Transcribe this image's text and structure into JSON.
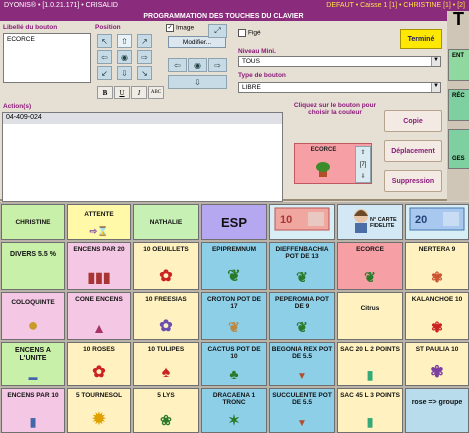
{
  "titlebar": {
    "left": "DYONIS® • [1.0.21.171] • CRISALID",
    "right": "DEFAUT • Caisse 1 [1] • CHRISTINE [1] • [2]"
  },
  "header": "PROGRAMMATION DES TOUCHES DU CLAVIER",
  "form": {
    "libelle_label": "Libellé du bouton",
    "libelle_value": "ECORCE",
    "position_label": "Position",
    "image_label": "Image",
    "image_checked": true,
    "modifier_label": "Modifier...",
    "fige_label": "Figé",
    "termine_label": "Terminé",
    "niveau_label": "Niveau Mini.",
    "niveau_value": "TOUS",
    "type_label": "Type de bouton",
    "type_value": "LIBRE",
    "format_bold": "B",
    "format_underline": "U",
    "format_italic": "I",
    "format_abc": "ABC",
    "action_label": "Action(s)",
    "action_value": "04-409-024",
    "hint": "Cliquez sur le bouton pour choisir la couleur",
    "preview_title": "ECORCE",
    "preview_count": "[7]",
    "copie_label": "Copie",
    "deplacement_label": "Déplacement",
    "suppression_label": "Suppression"
  },
  "right_strip": {
    "tile1": "ENT",
    "tile2": "RÉC",
    "tile3": "GES",
    "top_letter": "T"
  },
  "keys": {
    "row1": [
      "CHRISTINE",
      "ATTENTE",
      "NATHALIE",
      "ESP",
      "",
      "N° CARTE FIDELITE",
      ""
    ],
    "row2": [
      "DIVERS 5.5 %",
      "ENCENS PAR 20",
      "10 OEUILLETS",
      "EPIPREMNUM",
      "DIEFFENBACHIA POT DE 13",
      "ECORCE",
      "NERTERA 9"
    ],
    "row3": [
      "COLOQUINTE",
      "CONE ENCENS",
      "10 FREESIAS",
      "CROTON POT DE 17",
      "PEPEROMIA POT DE 9",
      "Citrus",
      "KALANCHOE 10"
    ],
    "row4": [
      "ENCENS A L'UNITE",
      "10 ROSES",
      "10 TULIPES",
      "CACTUS POT DE 10",
      "BEGONIA REX POT DE 5.5",
      "SAC 20 L 2 POINTS",
      "ST PAULIA 10"
    ],
    "row5": [
      "ENCENS PAR 10",
      "5 TOURNESOL",
      "5 LYS",
      "DRACAENA 1 TRONC",
      "SUCCULENTE POT DE 5.5",
      "SAC 45 L 3 POINTS",
      "rose => groupe"
    ]
  },
  "colors": {
    "accent": "#8b2b7c",
    "label": "#8b1a7a",
    "termine": "#ffe800"
  }
}
